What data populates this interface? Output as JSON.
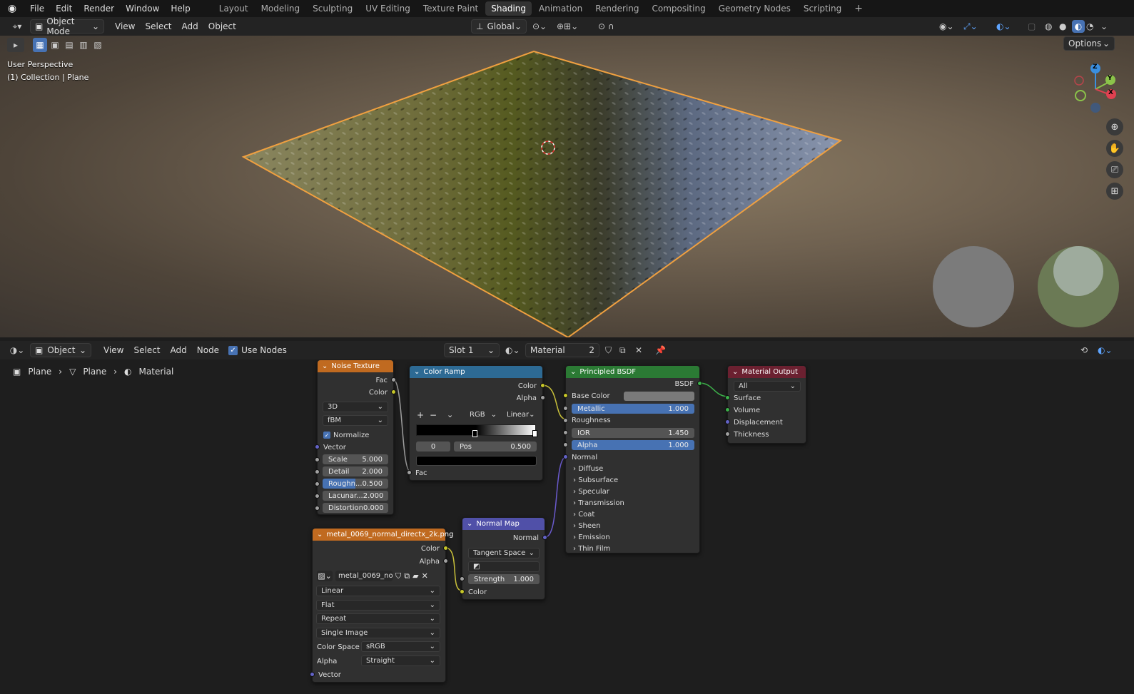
{
  "topbar": {
    "menus": [
      "File",
      "Edit",
      "Render",
      "Window",
      "Help"
    ],
    "workspaces": [
      "Layout",
      "Modeling",
      "Sculpting",
      "UV Editing",
      "Texture Paint",
      "Shading",
      "Animation",
      "Rendering",
      "Compositing",
      "Geometry Nodes",
      "Scripting"
    ],
    "active_workspace": "Shading",
    "add_tab": "+"
  },
  "viewport_header": {
    "mode": "Object Mode",
    "menus": [
      "View",
      "Select",
      "Add",
      "Object"
    ],
    "transform_orientation": "Global",
    "options_label": "Options"
  },
  "viewport": {
    "perspective": "User Perspective",
    "collection": "(1) Collection | Plane",
    "axes": {
      "z": "Z",
      "y": "Y",
      "x": "X"
    },
    "colors": {
      "selection_outline": "#f0a040",
      "axis_x": "#e04050",
      "axis_y": "#8bc34a",
      "axis_z": "#3a8fe0"
    }
  },
  "node_header": {
    "editor_type": "Object",
    "menus": [
      "View",
      "Select",
      "Add",
      "Node"
    ],
    "use_nodes_label": "Use Nodes",
    "slot": "Slot 1",
    "material": "Material",
    "users": "2"
  },
  "breadcrumb": [
    "Plane",
    "Plane",
    "Material"
  ],
  "nodes": {
    "noise": {
      "title": "Noise Texture",
      "out_fac": "Fac",
      "out_color": "Color",
      "dimensions": "3D",
      "type": "fBM",
      "normalize": "Normalize",
      "vector": "Vector",
      "scale_label": "Scale",
      "scale": "5.000",
      "detail_label": "Detail",
      "detail": "2.000",
      "roughness_label": "Roughn...",
      "roughness": "0.500",
      "lacunarity_label": "Lacunar...",
      "lacunarity": "2.000",
      "distortion_label": "Distortion",
      "distortion": "0.000",
      "color": "#c06a20"
    },
    "ramp": {
      "title": "Color Ramp",
      "out_color": "Color",
      "out_alpha": "Alpha",
      "add": "+",
      "remove": "−",
      "mode": "RGB",
      "interp": "Linear",
      "index": "0",
      "pos_label": "Pos",
      "pos": "0.500",
      "in_fac": "Fac",
      "color": "#2d6a94"
    },
    "bsdf": {
      "title": "Principled BSDF",
      "out": "BSDF",
      "base_color": "Base Color",
      "metallic_label": "Metallic",
      "metallic": "1.000",
      "roughness": "Roughness",
      "ior_label": "IOR",
      "ior": "1.450",
      "alpha_label": "Alpha",
      "alpha": "1.000",
      "normal": "Normal",
      "panels": [
        "Diffuse",
        "Subsurface",
        "Specular",
        "Transmission",
        "Coat",
        "Sheen",
        "Emission",
        "Thin Film"
      ],
      "color": "#2b7a34"
    },
    "output": {
      "title": "Material Output",
      "target": "All",
      "inputs": [
        "Surface",
        "Volume",
        "Displacement",
        "Thickness"
      ],
      "color": "#6b2030"
    },
    "image": {
      "title": "metal_0069_normal_directx_2k.png",
      "out_color": "Color",
      "out_alpha": "Alpha",
      "image_name": "metal_0069_no...",
      "interpolation": "Linear",
      "projection": "Flat",
      "extension": "Repeat",
      "source": "Single Image",
      "colorspace_label": "Color Space",
      "colorspace": "sRGB",
      "alpha_label": "Alpha",
      "alpha_mode": "Straight",
      "vector": "Vector",
      "color": "#c06a20"
    },
    "normalmap": {
      "title": "Normal Map",
      "out": "Normal",
      "space": "Tangent Space",
      "strength_label": "Strength",
      "strength": "1.000",
      "in_color": "Color",
      "color": "#5050a8"
    }
  }
}
